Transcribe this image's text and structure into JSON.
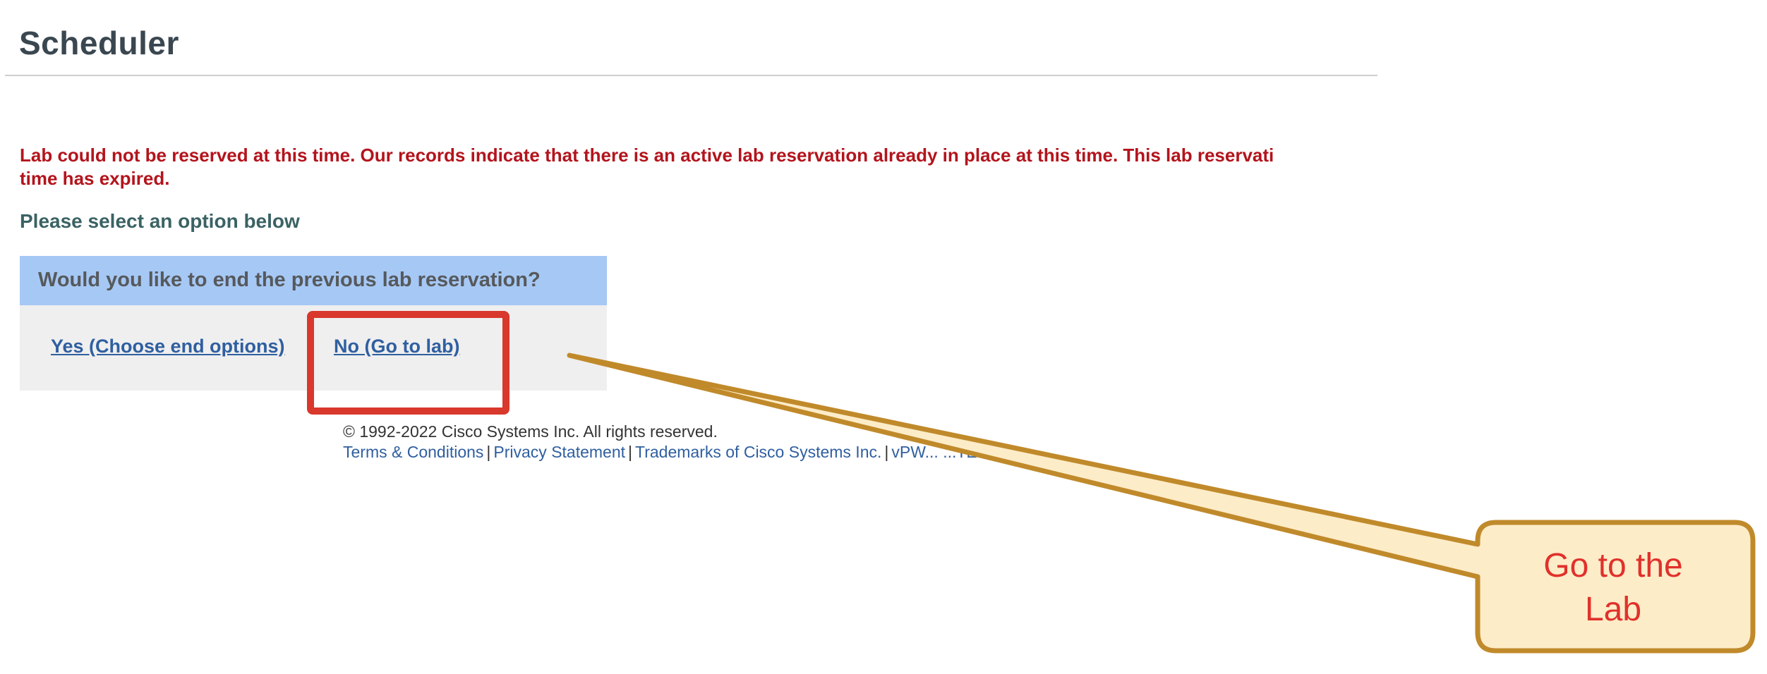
{
  "header": {
    "title": "Scheduler"
  },
  "message": {
    "error": "Lab could not be reserved at this time. Our records indicate that there is an active lab reservation already in place at this time. This lab reservati time has expired.",
    "error_line1": "Lab could not be reserved at this time. Our records indicate that there is an active lab reservation already in place at this time. This lab reservati",
    "error_line2": "time has expired.",
    "prompt": "Please select an option below"
  },
  "dialog": {
    "question": "Would you like to end the previous lab reservation?",
    "yes_label": "Yes (Choose end options)",
    "no_label": "No (Go to lab)"
  },
  "footer": {
    "copyright": "© 1992-2022 Cisco Systems Inc. All rights reserved.",
    "links": {
      "terms": "Terms & Conditions",
      "privacy": "Privacy Statement",
      "trademarks": "Trademarks of Cisco Systems Inc.",
      "version": "vPW... ...TE E"
    },
    "separator": "|"
  },
  "annotation": {
    "callout_text": "Go to the Lab",
    "callout_line1": "Go to the",
    "callout_line2": "Lab",
    "colors": {
      "callout_fill": "#fdecc8",
      "callout_border": "#c08a2b",
      "callout_text": "#e0312b",
      "highlight_border": "#d9382c"
    }
  },
  "colors": {
    "title": "#3a4750",
    "error": "#b3141c",
    "prompt": "#3b6264",
    "dialog_header_bg": "#a6c8f5",
    "dialog_body_bg": "#efefef",
    "link": "#2f5fa0"
  }
}
